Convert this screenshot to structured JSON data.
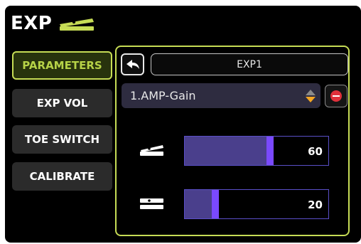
{
  "header": {
    "title": "EXP",
    "icon": "expression-pedal-icon"
  },
  "menu": [
    {
      "label": "PARAMETERS",
      "active": true
    },
    {
      "label": "EXP VOL",
      "active": false
    },
    {
      "label": "TOE SWITCH",
      "active": false
    },
    {
      "label": "CALIBRATE",
      "active": false
    }
  ],
  "panel": {
    "exp_name": "EXP1",
    "parameter": "1.AMP-Gain",
    "sliders": [
      {
        "label_icon": "pedal-toe-down-icon",
        "value": "60",
        "percent": 60
      },
      {
        "label_icon": "pedal-heel-down-icon",
        "value": "20",
        "percent": 20
      }
    ]
  },
  "colors": {
    "accent": "#c6dc55",
    "slider_fill": "#4a3f8c",
    "slider_handle": "#7a49ff",
    "select_bg": "#2e2c40",
    "remove": "#e0303b",
    "spin": "#f5a623"
  }
}
